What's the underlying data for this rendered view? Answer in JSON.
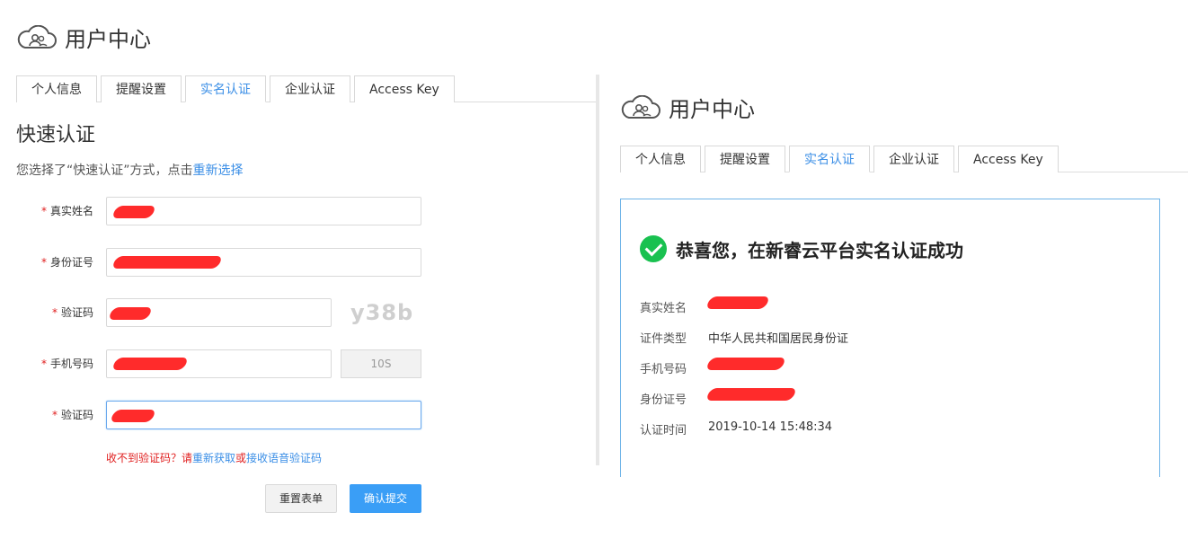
{
  "left": {
    "header": {
      "title": "用户中心"
    },
    "tabs": [
      {
        "label": "个人信息"
      },
      {
        "label": "提醒设置"
      },
      {
        "label": "实名认证",
        "active": true
      },
      {
        "label": "企业认证"
      },
      {
        "label": "Access Key"
      }
    ],
    "section_title": "快速认证",
    "desc_prefix": "您选择了“快速认证”方式，点击",
    "desc_link": "重新选择",
    "form": {
      "required_mark": "*",
      "name_label": "真实姓名",
      "id_label": "身份证号",
      "captcha_label": "验证码",
      "captcha_text": "y38b",
      "phone_label": "手机号码",
      "sms_button": "10S",
      "sms_code_label": "验证码"
    },
    "tip_prefix": "收不到验证码？请",
    "tip_link1": "重新获取",
    "tip_or": "或",
    "tip_link2": "接收语音验证码",
    "reset_button": "重置表单",
    "submit_button": "确认提交"
  },
  "right": {
    "header": {
      "title": "用户中心"
    },
    "tabs": [
      {
        "label": "个人信息"
      },
      {
        "label": "提醒设置"
      },
      {
        "label": "实名认证",
        "active": true
      },
      {
        "label": "企业认证"
      },
      {
        "label": "Access Key"
      }
    ],
    "success_title": "恭喜您，在新睿云平台实名认证成功",
    "info": {
      "name_key": "真实姓名",
      "cert_type_key": "证件类型",
      "cert_type_value": "中华人民共和国居民身份证",
      "phone_key": "手机号码",
      "id_key": "身份证号",
      "time_key": "认证时间",
      "time_value": "2019-10-14 15:48:34"
    }
  },
  "colors": {
    "accent": "#3a8ee6",
    "primary_button": "#3a9ef6",
    "success": "#19c150",
    "required": "#e02020"
  }
}
